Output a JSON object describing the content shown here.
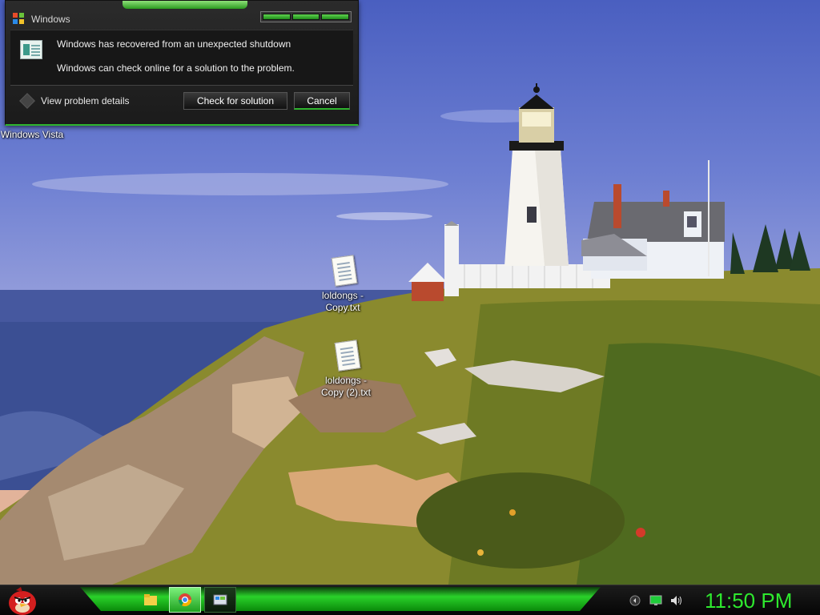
{
  "dialog": {
    "title": "Windows",
    "message_1": "Windows has recovered from an unexpected shutdown",
    "message_2": "Windows can check online for a solution to the problem.",
    "details_label": "View problem details",
    "check_button": "Check for solution",
    "cancel_button": "Cancel"
  },
  "desktop_icons": [
    {
      "label": "Windows Vista",
      "icon": "windows-vista-icon"
    },
    {
      "label": "loldongs - Copy.txt",
      "icon": "text-file-icon"
    },
    {
      "label": "loldongs - Copy (2).txt",
      "icon": "text-file-icon"
    }
  ],
  "taskbar": {
    "start_icon": "angry-bird-start-icon",
    "pinned": [
      "folder-icon",
      "chrome-icon",
      "windows-app-icon"
    ],
    "tray": [
      "network-arrow-icon",
      "monitor-icon",
      "volume-icon"
    ],
    "clock": "11:50 PM"
  },
  "colors": {
    "accent_green": "#2ee82e",
    "dialog_bg": "#1b1b1b"
  }
}
